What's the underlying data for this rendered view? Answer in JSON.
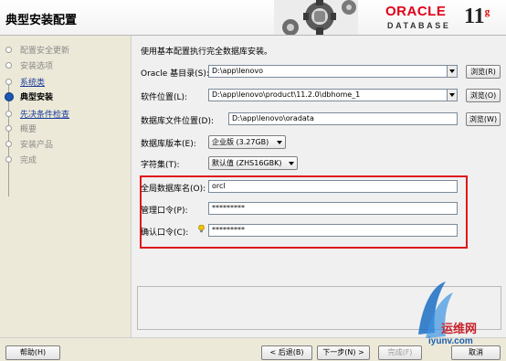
{
  "header": {
    "title": "典型安装配置",
    "logo": {
      "brand": "ORACLE",
      "product": "DATABASE",
      "version": "11",
      "version_suffix": "g"
    }
  },
  "sidebar": {
    "steps": [
      {
        "label": "配置安全更新",
        "state": "done"
      },
      {
        "label": "安装选项",
        "state": "done"
      },
      {
        "label": "系统类",
        "state": "link"
      },
      {
        "label": "典型安装",
        "state": "current"
      },
      {
        "label": "先决条件检查",
        "state": "link"
      },
      {
        "label": "概要",
        "state": "pending"
      },
      {
        "label": "安装产品",
        "state": "pending"
      },
      {
        "label": "完成",
        "state": "pending"
      }
    ]
  },
  "form": {
    "intro": "使用基本配置执行完全数据库安装。",
    "oracle_base": {
      "label": "Oracle 基目录(S):",
      "value": "D:\\app\\lenovo",
      "browse": "浏览(R)"
    },
    "software_location": {
      "label": "软件位置(L):",
      "value": "D:\\app\\lenovo\\product\\11.2.0\\dbhome_1",
      "browse": "浏览(O)"
    },
    "datafile_location": {
      "label": "数据库文件位置(D):",
      "value": "D:\\app\\lenovo\\oradata",
      "browse": "浏览(W)"
    },
    "db_edition": {
      "label": "数据库版本(E):",
      "value": "企业版 (3.27GB)"
    },
    "charset": {
      "label": "字符集(T):",
      "value": "默认值 (ZHS16GBK)"
    },
    "global_db_name": {
      "label": "全局数据库名(O):",
      "value": "orcl"
    },
    "admin_password": {
      "label": "管理口令(P):",
      "value": "*********"
    },
    "confirm_password": {
      "label": "确认口令(C):",
      "value": "*********"
    }
  },
  "footer": {
    "help": "帮助(H)",
    "back": "< 后退(B)",
    "next": "下一步(N) >",
    "finish": "完成(F)",
    "cancel": "取消"
  },
  "watermark": {
    "text_cn": "运维网",
    "url": "iyunv.com"
  },
  "colors": {
    "accent_red": "#e01818",
    "link_blue": "#1a3c9c",
    "oracle_red": "#e0001a"
  }
}
